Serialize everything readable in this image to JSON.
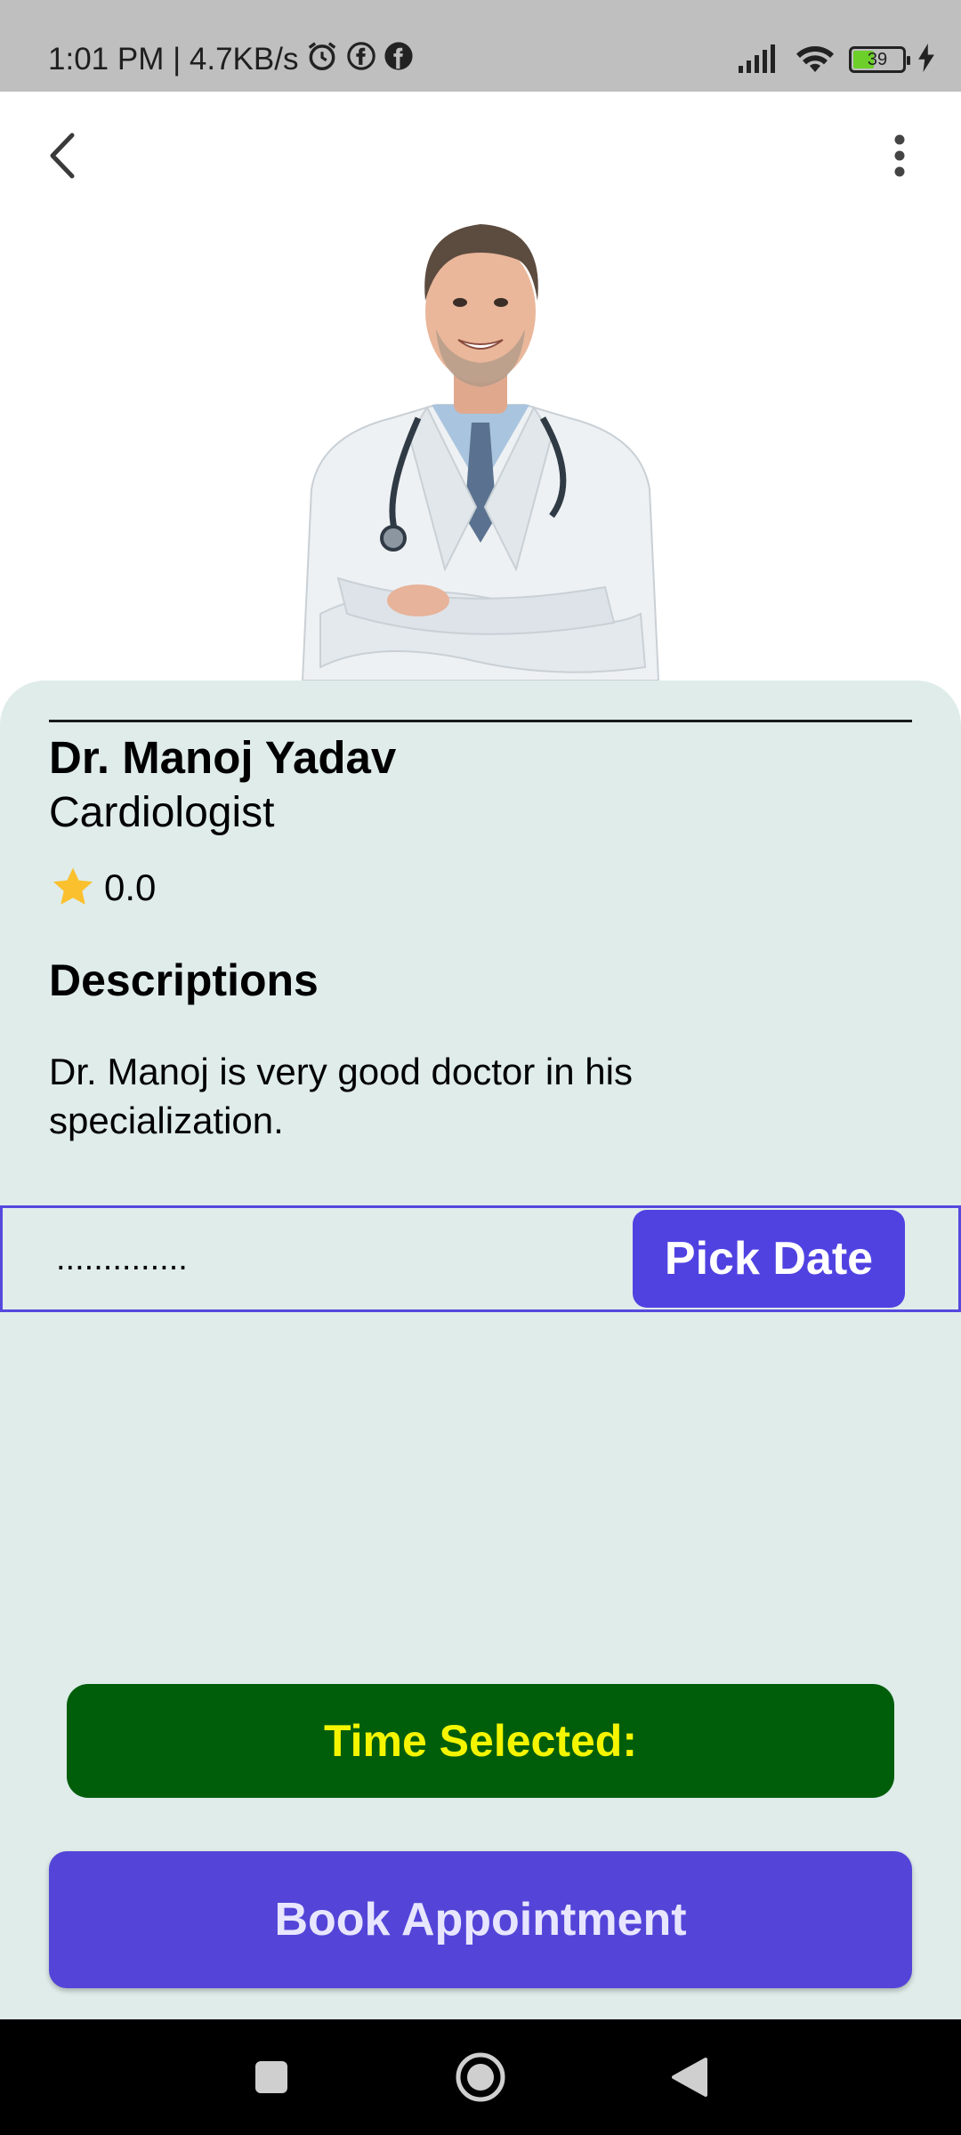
{
  "status_bar": {
    "time_speed": "1:01 PM | 4.7KB/s",
    "battery_level": "39",
    "icons": [
      "alarm-icon",
      "facebook-icon",
      "facebook-icon",
      "signal-icon",
      "wifi-icon",
      "battery-icon",
      "charging-icon"
    ]
  },
  "app_bar": {
    "icons": [
      "back-arrow-icon",
      "more-vert-icon"
    ]
  },
  "doctor": {
    "name": "Dr. Manoj Yadav",
    "specialty": "Cardiologist",
    "rating": "0.0",
    "description_heading": "Descriptions",
    "description": "Dr. Manoj is very good doctor in his specialization."
  },
  "date_picker": {
    "value": "..............",
    "button_label": "Pick Date"
  },
  "time": {
    "label": "Time Selected:"
  },
  "actions": {
    "book_label": "Book Appointment"
  },
  "colors": {
    "sheet_bg": "#dfecea",
    "primary": "#5042e1",
    "time_bg": "#005e0b",
    "time_text": "#f5f500",
    "star": "#fbc02d"
  },
  "nav_bar": {
    "icons": [
      "recents-square-icon",
      "home-circle-icon",
      "back-triangle-icon"
    ]
  }
}
